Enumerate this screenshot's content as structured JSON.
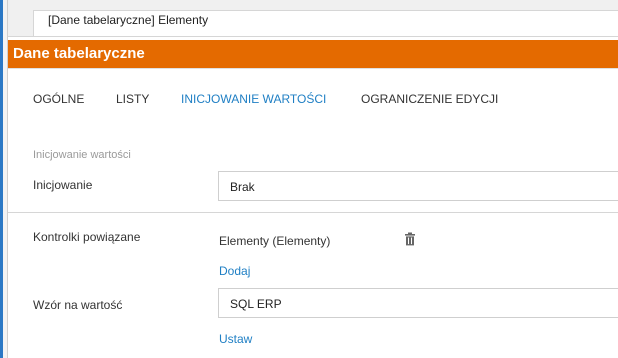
{
  "window": {
    "title": "[Dane tabelaryczne] Elementy"
  },
  "header": {
    "title": "Dane tabelaryczne"
  },
  "tabs": [
    {
      "label": "OGÓLNE",
      "active": false
    },
    {
      "label": "LISTY",
      "active": false
    },
    {
      "label": "INICJOWANIE WARTOŚCI",
      "active": true
    },
    {
      "label": "OGRANICZENIE EDYCJI",
      "active": false
    }
  ],
  "section": {
    "label": "Inicjowanie wartości"
  },
  "init": {
    "label": "Inicjowanie",
    "value": "Brak"
  },
  "linked_controls": {
    "label": "Kontrolki powiązane",
    "item": "Elementy (Elementy)",
    "icon": "trash-icon",
    "add_link": "Dodaj"
  },
  "pattern": {
    "label": "Wzór na wartość",
    "value": "SQL ERP",
    "set_link": "Ustaw"
  },
  "colors": {
    "accent": "#e46a00",
    "link": "#1f7fc4",
    "window_bar": "#2b78c5"
  }
}
